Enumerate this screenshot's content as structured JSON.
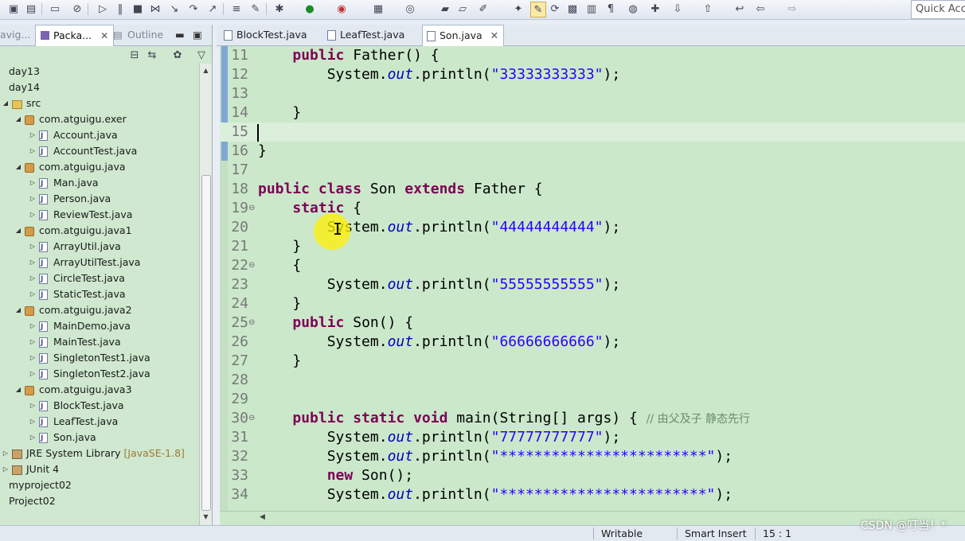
{
  "toolbar": {
    "quick_access": "Quick Access"
  },
  "left_tabs": [
    {
      "label": "avig..."
    },
    {
      "label": "Packa...",
      "active": true
    },
    {
      "label": "Outline"
    }
  ],
  "tree": [
    {
      "label": "day13",
      "type": "folder",
      "level": 0,
      "twisty": ""
    },
    {
      "label": "day14",
      "type": "folder",
      "level": 0,
      "twisty": ""
    },
    {
      "label": "src",
      "type": "src",
      "level": 0,
      "twisty": "◢"
    },
    {
      "label": "com.atguigu.exer",
      "type": "pkg",
      "level": 1,
      "twisty": "◢"
    },
    {
      "label": "Account.java",
      "type": "java",
      "level": 2,
      "twisty": "▷"
    },
    {
      "label": "AccountTest.java",
      "type": "java",
      "level": 2,
      "twisty": "▷"
    },
    {
      "label": "com.atguigu.java",
      "type": "pkg",
      "level": 1,
      "twisty": "◢"
    },
    {
      "label": "Man.java",
      "type": "java",
      "level": 2,
      "twisty": "▷"
    },
    {
      "label": "Person.java",
      "type": "java",
      "level": 2,
      "twisty": "▷"
    },
    {
      "label": "ReviewTest.java",
      "type": "java",
      "level": 2,
      "twisty": "▷"
    },
    {
      "label": "com.atguigu.java1",
      "type": "pkg",
      "level": 1,
      "twisty": "◢"
    },
    {
      "label": "ArrayUtil.java",
      "type": "java",
      "level": 2,
      "twisty": "▷"
    },
    {
      "label": "ArrayUtilTest.java",
      "type": "java",
      "level": 2,
      "twisty": "▷"
    },
    {
      "label": "CircleTest.java",
      "type": "java",
      "level": 2,
      "twisty": "▷"
    },
    {
      "label": "StaticTest.java",
      "type": "java",
      "level": 2,
      "twisty": "▷"
    },
    {
      "label": "com.atguigu.java2",
      "type": "pkg",
      "level": 1,
      "twisty": "◢"
    },
    {
      "label": "MainDemo.java",
      "type": "java",
      "level": 2,
      "twisty": "▷"
    },
    {
      "label": "MainTest.java",
      "type": "java",
      "level": 2,
      "twisty": "▷"
    },
    {
      "label": "SingletonTest1.java",
      "type": "java",
      "level": 2,
      "twisty": "▷"
    },
    {
      "label": "SingletonTest2.java",
      "type": "java",
      "level": 2,
      "twisty": "▷"
    },
    {
      "label": "com.atguigu.java3",
      "type": "pkg",
      "level": 1,
      "twisty": "◢"
    },
    {
      "label": "BlockTest.java",
      "type": "java",
      "level": 2,
      "twisty": "▷"
    },
    {
      "label": "LeafTest.java",
      "type": "java",
      "level": 2,
      "twisty": "▷"
    },
    {
      "label": "Son.java",
      "type": "java",
      "level": 2,
      "twisty": "▷"
    },
    {
      "label": "JRE System Library",
      "hint": "[JavaSE-1.8]",
      "type": "lib",
      "level": 0,
      "twisty": "▷"
    },
    {
      "label": "JUnit 4",
      "type": "lib",
      "level": 0,
      "twisty": "▷"
    },
    {
      "label": "myproject02",
      "type": "folder",
      "level": -1,
      "twisty": ""
    },
    {
      "label": "Project02",
      "type": "folder",
      "level": -1,
      "twisty": ""
    }
  ],
  "editor_tabs": [
    {
      "label": "BlockTest.java",
      "active": false
    },
    {
      "label": "LeafTest.java",
      "active": false
    },
    {
      "label": "Son.java",
      "active": true
    }
  ],
  "code_lines": [
    {
      "n": "11",
      "html": "    <span class=\"kw\">public</span> Father() {",
      "fold": ""
    },
    {
      "n": "12",
      "html": "        System.<span class=\"fld\">out</span>.println(<span class=\"str\">\"33333333333\"</span>);",
      "fold": ""
    },
    {
      "n": "13",
      "html": "",
      "fold": ""
    },
    {
      "n": "14",
      "html": "    }",
      "fold": ""
    },
    {
      "n": "15",
      "html": "",
      "fold": "",
      "current": true
    },
    {
      "n": "16",
      "html": "}",
      "fold": ""
    },
    {
      "n": "17",
      "html": "",
      "fold": ""
    },
    {
      "n": "18",
      "html": "<span class=\"kw\">public class</span> Son <span class=\"kw\">extends</span> Father {",
      "fold": ""
    },
    {
      "n": "19",
      "html": "    <span class=\"kw\">static</span> {",
      "fold": "⊖"
    },
    {
      "n": "20",
      "html": "        System.<span class=\"fld\">out</span>.println(<span class=\"str\">\"44444444444\"</span>);",
      "fold": ""
    },
    {
      "n": "21",
      "html": "    }",
      "fold": ""
    },
    {
      "n": "22",
      "html": "    {",
      "fold": "⊖"
    },
    {
      "n": "23",
      "html": "        System.<span class=\"fld\">out</span>.println(<span class=\"str\">\"55555555555\"</span>);",
      "fold": ""
    },
    {
      "n": "24",
      "html": "    }",
      "fold": ""
    },
    {
      "n": "25",
      "html": "    <span class=\"kw\">public</span> Son() {",
      "fold": "⊖"
    },
    {
      "n": "26",
      "html": "        System.<span class=\"fld\">out</span>.println(<span class=\"str\">\"66666666666\"</span>);",
      "fold": ""
    },
    {
      "n": "27",
      "html": "    }",
      "fold": ""
    },
    {
      "n": "28",
      "html": "",
      "fold": ""
    },
    {
      "n": "29",
      "html": "",
      "fold": ""
    },
    {
      "n": "30",
      "html": "    <span class=\"kw\">public static void</span> main(String[] args) { <span class=\"cmt\">// 由父及子 静态先行</span>",
      "fold": "⊖"
    },
    {
      "n": "31",
      "html": "        System.<span class=\"fld\">out</span>.println(<span class=\"str\">\"77777777777\"</span>);",
      "fold": ""
    },
    {
      "n": "32",
      "html": "        System.<span class=\"fld\">out</span>.println(<span class=\"str\">\"************************\"</span>);",
      "fold": ""
    },
    {
      "n": "33",
      "html": "        <span class=\"kw\">new</span> Son();",
      "fold": ""
    },
    {
      "n": "34",
      "html": "        System.<span class=\"fld\">out</span>.println(<span class=\"str\">\"************************\"</span>);",
      "fold": ""
    }
  ],
  "status": {
    "writable": "Writable",
    "insert_mode": "Smart Insert",
    "position": "15 : 1"
  },
  "watermark": "CSDN @叮当！*",
  "colors": {
    "editor_bg": "#cbe8cb",
    "keyword": "#7f0055",
    "string": "#2a00ff",
    "field": "#0000c0"
  }
}
